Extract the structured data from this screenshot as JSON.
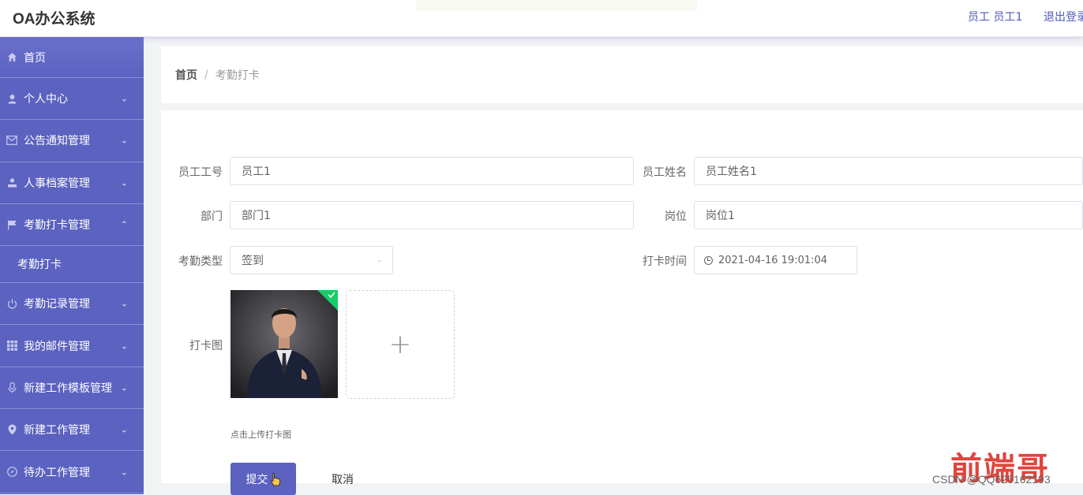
{
  "app": {
    "title": "OA办公系统"
  },
  "header": {
    "user_label": "员工 员工1",
    "logout_label": "退出登录"
  },
  "sidebar": {
    "items": [
      {
        "label": "首页",
        "icon": "home-icon",
        "chevron": ""
      },
      {
        "label": "个人中心",
        "icon": "user-icon",
        "chevron": "chevron-down"
      },
      {
        "label": "公告通知管理",
        "icon": "mail-icon",
        "chevron": "chevron-down"
      },
      {
        "label": "人事档案管理",
        "icon": "person-stamp-icon",
        "chevron": "chevron-down"
      },
      {
        "label": "考勤打卡管理",
        "icon": "flag-icon",
        "chevron": "chevron-up"
      },
      {
        "label": "考勤打卡",
        "icon": "",
        "chevron": ""
      },
      {
        "label": "考勤记录管理",
        "icon": "power-icon",
        "chevron": "chevron-down"
      },
      {
        "label": "我的邮件管理",
        "icon": "grid-icon",
        "chevron": "chevron-down"
      },
      {
        "label": "新建工作模板管理",
        "icon": "microphone-icon",
        "chevron": "chevron-down"
      },
      {
        "label": "新建工作管理",
        "icon": "location-icon",
        "chevron": "chevron-down"
      },
      {
        "label": "待办工作管理",
        "icon": "compass-icon",
        "chevron": "chevron-down"
      }
    ]
  },
  "breadcrumb": {
    "home": "首页",
    "separator": "/",
    "current": "考勤打卡"
  },
  "form": {
    "employee_no": {
      "label": "员工工号",
      "value": "员工1"
    },
    "employee_name": {
      "label": "员工姓名",
      "value": "员工姓名1"
    },
    "department": {
      "label": "部门",
      "value": "部门1"
    },
    "position": {
      "label": "岗位",
      "value": "岗位1"
    },
    "attendance_type": {
      "label": "考勤类型",
      "value": "签到"
    },
    "clock_time": {
      "label": "打卡时间",
      "value": "2021-04-16 19:01:04"
    },
    "photo": {
      "label": "打卡图",
      "hint": "点击上传打卡图"
    },
    "submit_label": "提交",
    "cancel_label": "取消"
  },
  "watermark": {
    "logo_text": "前端哥",
    "caption": "CSDN @QQ625162193"
  },
  "colors": {
    "brand": "#5b62c0",
    "link": "#4e58b8",
    "watermark": "#e0453d"
  }
}
